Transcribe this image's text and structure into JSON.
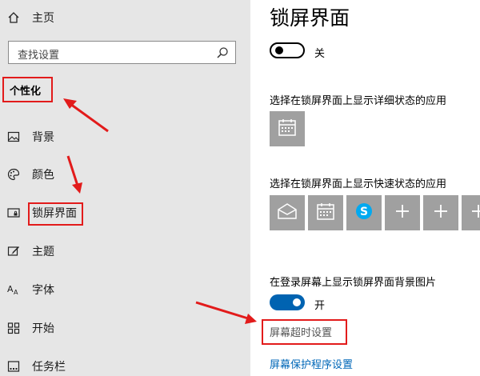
{
  "sidebar": {
    "home_label": "主页",
    "search_placeholder": "查找设置",
    "section_header": "个性化",
    "items": [
      {
        "label": "背景",
        "icon": "picture-icon"
      },
      {
        "label": "颜色",
        "icon": "palette-icon"
      },
      {
        "label": "锁屏界面",
        "icon": "lock-screen-icon"
      },
      {
        "label": "主题",
        "icon": "theme-brush-icon"
      },
      {
        "label": "字体",
        "icon": "font-icon"
      },
      {
        "label": "开始",
        "icon": "start-grid-icon"
      },
      {
        "label": "任务栏",
        "icon": "taskbar-icon"
      }
    ]
  },
  "main": {
    "title": "锁屏界面",
    "slideshow_toggle": {
      "state_label": "关",
      "on": false
    },
    "detailed_status_label": "选择在锁屏界面上显示详细状态的应用",
    "detailed_status_apps": [
      {
        "icon": "calendar-icon"
      }
    ],
    "quick_status_label": "选择在锁屏界面上显示快速状态的应用",
    "quick_status_apps": [
      {
        "icon": "mail-icon"
      },
      {
        "icon": "calendar-icon"
      },
      {
        "icon": "skype-icon"
      },
      {
        "icon": "plus-icon"
      },
      {
        "icon": "plus-icon"
      },
      {
        "icon": "plus-icon"
      }
    ],
    "signin_background_label": "在登录屏幕上显示锁屏界面背景图片",
    "signin_toggle": {
      "state_label": "开",
      "on": true
    },
    "timeout_link": "屏幕超时设置",
    "screensaver_link": "屏幕保护程序设置"
  },
  "colors": {
    "sidebar_bg": "#e6e6e6",
    "accent": "#0063b1",
    "link": "#0067b8",
    "tile": "#a0a0a0",
    "annotation": "#e21b1b"
  }
}
